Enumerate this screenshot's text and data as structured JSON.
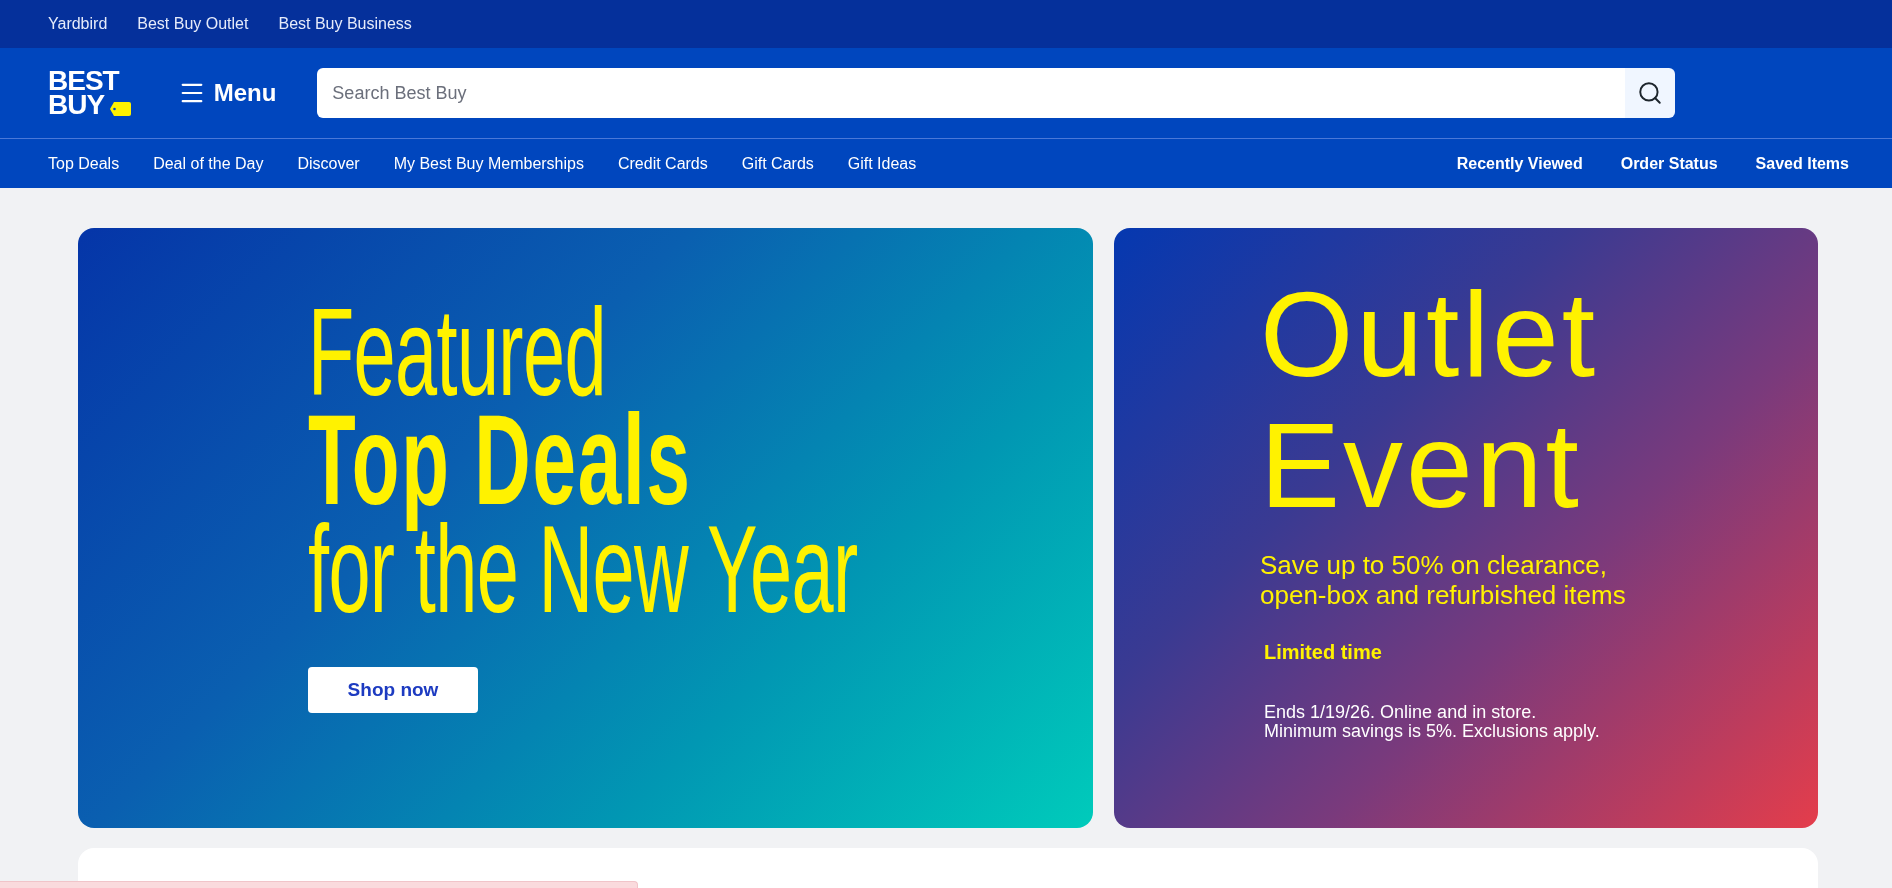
{
  "top_bar": {
    "links": [
      "Yardbird",
      "Best Buy Outlet",
      "Best Buy Business"
    ]
  },
  "header": {
    "logo": {
      "lines": [
        "BEST",
        "BUY"
      ]
    },
    "menu_button": {
      "label": "Menu"
    },
    "search": {
      "placeholder": "Search Best Buy"
    }
  },
  "nav": {
    "links": [
      "Top Deals",
      "Deal of the Day",
      "Discover",
      "My Best Buy Memberships",
      "Credit Cards",
      "Gift Cards",
      "Gift Ideas"
    ],
    "account_links": [
      "Recently Viewed",
      "Order Status",
      "Saved Items"
    ]
  },
  "banners": [
    {
      "kind": "headline",
      "lines": [
        "Featured",
        "**Top Deals**",
        "for the New Year"
      ],
      "button": "Shop now"
    },
    {
      "kind": "event",
      "title_lines": [
        "Outlet",
        "Event"
      ],
      "subtitle_lines": [
        "Save up to 50% on clearance,",
        "open-box and refurbished items"
      ],
      "badge": "Limited time",
      "fine_print_lines": [
        "Ends 1/19/26. Online and in store.",
        "Minimum savings is 5%. Exclusions apply."
      ]
    }
  ]
}
